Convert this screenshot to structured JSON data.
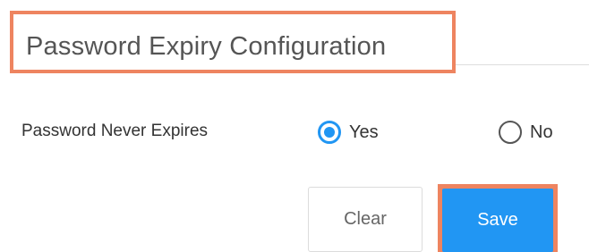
{
  "header": {
    "title": "Password Expiry Configuration"
  },
  "form": {
    "password_never_expires": {
      "label": "Password Never Expires",
      "options": [
        {
          "label": "Yes",
          "selected": true
        },
        {
          "label": "No",
          "selected": false
        }
      ]
    }
  },
  "actions": {
    "clear_label": "Clear",
    "save_label": "Save"
  },
  "colors": {
    "accent": "#2196f3",
    "highlight": "#ee8460",
    "button_text": "#ffffff"
  }
}
